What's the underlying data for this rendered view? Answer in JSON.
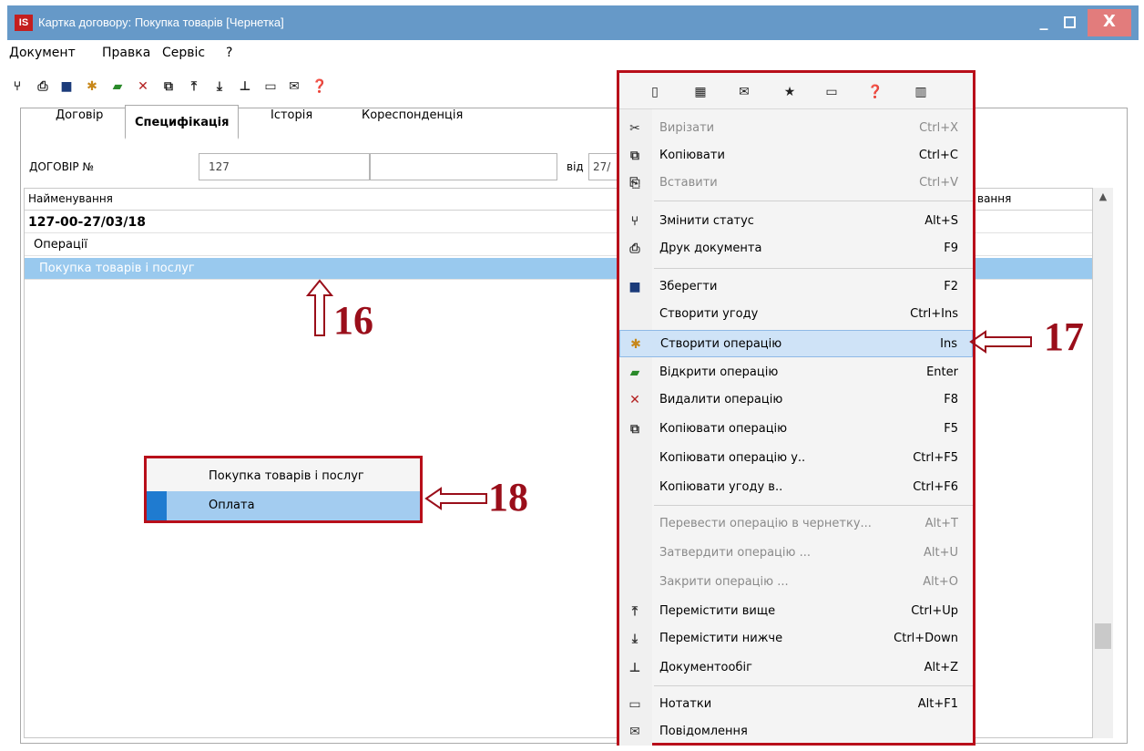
{
  "window": {
    "logo": "IS",
    "title": "Картка договору: Покупка товарів [Чернетка]",
    "minimize": "_",
    "close": "X"
  },
  "menubar": [
    "Документ",
    "Правка",
    "Сервіс",
    "?"
  ],
  "tabs": [
    {
      "label": "Договір",
      "active": false
    },
    {
      "label": "Специфікація",
      "active": true
    },
    {
      "label": "Історія",
      "active": false
    },
    {
      "label": "Кореспонденція",
      "active": false
    }
  ],
  "contract": {
    "label": "ДОГОВІР №",
    "number": "127",
    "extra": "",
    "date_label": "від",
    "date_value": "27/"
  },
  "grid": {
    "header": "Найменування",
    "header_right": "вання",
    "rows": [
      {
        "text": "127-00-27/03/18",
        "style": "bold"
      },
      {
        "text": "Операції",
        "style": "normal"
      },
      {
        "text": "Покупка товарів і послуг",
        "style": "selected"
      }
    ]
  },
  "context_menu": {
    "items": [
      {
        "label": "Вирізати",
        "shortcut": "Ctrl+X",
        "icon": "cut-icon",
        "disabled": true
      },
      {
        "label": "Копіювати",
        "shortcut": "Ctrl+C",
        "icon": "copy-icon",
        "disabled": false
      },
      {
        "label": "Вставити",
        "shortcut": "Ctrl+V",
        "icon": "paste-icon",
        "disabled": true
      },
      {
        "label": "Змінити статус",
        "shortcut": "Alt+S",
        "icon": "status-icon",
        "disabled": false
      },
      {
        "label": "Друк документа",
        "shortcut": "F9",
        "icon": "print-icon",
        "disabled": false
      },
      {
        "label": "Зберегти",
        "shortcut": "F2",
        "icon": "save-icon",
        "disabled": false
      },
      {
        "label": "Створити угоду",
        "shortcut": "Ctrl+Ins",
        "icon": "",
        "disabled": false
      },
      {
        "label": "Створити операцію",
        "shortcut": "Ins",
        "icon": "create-operation-icon",
        "disabled": false,
        "hover": true
      },
      {
        "label": "Відкрити операцію",
        "shortcut": "Enter",
        "icon": "open-operation-icon",
        "disabled": false
      },
      {
        "label": "Видалити операцію",
        "shortcut": "F8",
        "icon": "delete-operation-icon",
        "disabled": false
      },
      {
        "label": "Копіювати операцію",
        "shortcut": "F5",
        "icon": "copy-operation-icon",
        "disabled": false
      },
      {
        "label": "Копіювати операцію у..",
        "shortcut": "Ctrl+F5",
        "icon": "",
        "disabled": false
      },
      {
        "label": "Копіювати угоду в..",
        "shortcut": "Ctrl+F6",
        "icon": "",
        "disabled": false
      },
      {
        "label": "Перевести операцію в чернетку...",
        "shortcut": "Alt+T",
        "icon": "",
        "disabled": true
      },
      {
        "label": "Затвердити операцію ...",
        "shortcut": "Alt+U",
        "icon": "",
        "disabled": true
      },
      {
        "label": "Закрити операцію ...",
        "shortcut": "Alt+O",
        "icon": "",
        "disabled": true
      },
      {
        "label": "Перемістити вище",
        "shortcut": "Ctrl+Up",
        "icon": "move-up-icon",
        "disabled": false
      },
      {
        "label": "Перемістити нижче",
        "shortcut": "Ctrl+Down",
        "icon": "move-down-icon",
        "disabled": false
      },
      {
        "label": "Документообіг",
        "shortcut": "Alt+Z",
        "icon": "workflow-icon",
        "disabled": false
      },
      {
        "label": "Нотатки",
        "shortcut": "Alt+F1",
        "icon": "notes-icon",
        "disabled": false
      },
      {
        "label": "Повідомлення",
        "shortcut": "",
        "icon": "message-icon",
        "disabled": false
      }
    ]
  },
  "popup": {
    "items": [
      {
        "label": "Покупка товарів і послуг",
        "selected": false
      },
      {
        "label": "Оплата",
        "selected": true
      }
    ]
  },
  "callouts": {
    "c16": "16",
    "c17": "17",
    "c18": "18"
  },
  "colors": {
    "titlebar": "#6699c8",
    "selection": "#99c9ee",
    "menu_hover": "#cfe3f7",
    "callout": "#9a0e1a"
  }
}
